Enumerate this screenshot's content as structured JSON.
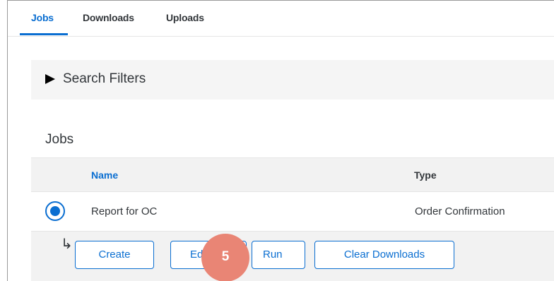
{
  "tabs": [
    {
      "label": "Jobs",
      "active": true
    },
    {
      "label": "Downloads",
      "active": false
    },
    {
      "label": "Uploads",
      "active": false
    }
  ],
  "filters": {
    "label": "Search Filters",
    "icon": "triangle-right-icon"
  },
  "jobs": {
    "title": "Jobs",
    "columns": [
      "Name",
      "Type"
    ],
    "rows": [
      {
        "selected": true,
        "name": "Report for OC",
        "type": "Order Confirmation"
      }
    ]
  },
  "actions": {
    "arrow_icon": "↳",
    "create": "Create",
    "edit": "Ed",
    "run": "Run",
    "clear_downloads": "Clear Downloads"
  },
  "step_badge": "5",
  "colors": {
    "accent": "#0a6ed1",
    "badge": "#e98575",
    "panel": "#f2f2f2"
  }
}
